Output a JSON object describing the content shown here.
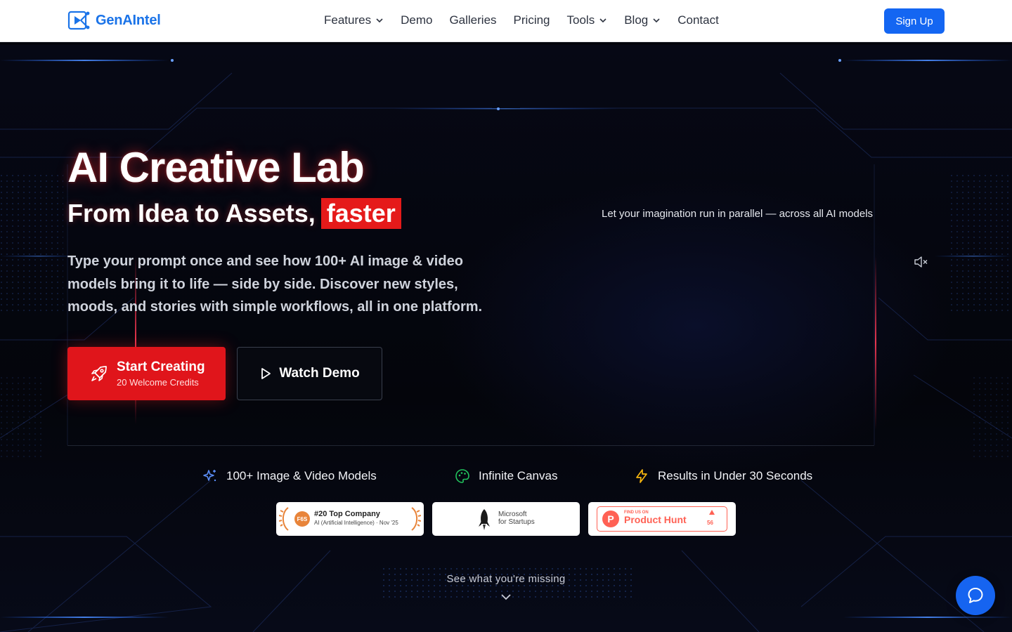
{
  "nav": {
    "logo_text": "GenAIntel",
    "items": [
      {
        "label": "Features",
        "dropdown": true
      },
      {
        "label": "Demo",
        "dropdown": false
      },
      {
        "label": "Galleries",
        "dropdown": false
      },
      {
        "label": "Pricing",
        "dropdown": false
      },
      {
        "label": "Tools",
        "dropdown": true
      },
      {
        "label": "Blog",
        "dropdown": true
      },
      {
        "label": "Contact",
        "dropdown": false
      }
    ],
    "signup_label": "Sign Up"
  },
  "hero": {
    "title": "AI Creative Lab",
    "subtitle_prefix": "From Idea to Assets,",
    "subtitle_highlight": "faster",
    "description": "Type your prompt once and see how 100+ AI image & video models bring it to life — side by side. Discover new styles, moods, and stories with simple workflows, all in one platform.",
    "tagline": "Let your imagination run in parallel — across all AI models",
    "primary_button": {
      "label": "Start Creating",
      "sublabel": "20 Welcome Credits"
    },
    "secondary_button": {
      "label": "Watch Demo"
    }
  },
  "features": [
    {
      "label": "100+ Image & Video Models",
      "icon": "sparkles-icon",
      "color": "#5b8df6"
    },
    {
      "label": "Infinite Canvas",
      "icon": "palette-icon",
      "color": "#22c55e"
    },
    {
      "label": "Results in Under 30 Seconds",
      "icon": "lightning-icon",
      "color": "#f5b50f"
    }
  ],
  "badges": {
    "f6s": {
      "rank": "#20 Top Company",
      "category": "AI (Artificial Intelligence) · Nov '25",
      "logo": "F6S"
    },
    "microsoft": {
      "line1": "Microsoft",
      "line2": "for Startups"
    },
    "producthunt": {
      "small": "FIND US ON",
      "name": "Product Hunt",
      "votes": "56"
    }
  },
  "scroll_hint": "See what you're missing",
  "colors": {
    "brand": "#1a73e8",
    "accent_red": "#e0151b",
    "signup_blue": "#1466f2",
    "chat_blue": "#1664f0"
  }
}
